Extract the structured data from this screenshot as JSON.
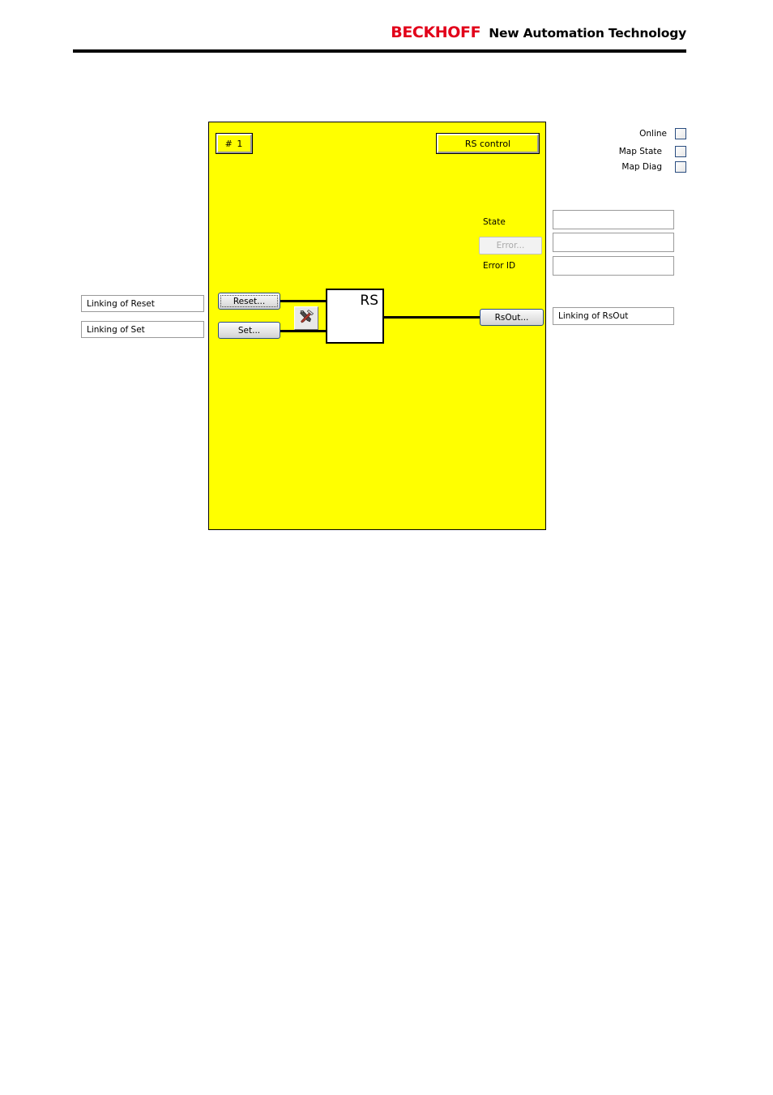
{
  "header": {
    "brand_name": "BECKHOFF",
    "tagline": "New Automation Technology"
  },
  "editor": {
    "index_button": "# 1",
    "title_button": "RS control",
    "state_label": "State",
    "error_button": "Error...",
    "error_id_label": "Error ID",
    "reset_button": "Reset...",
    "set_button": "Set...",
    "rsout_button": "RsOut...",
    "tools_button_icon": "tools-icon",
    "function_block_label": "RS",
    "panel_color": "#ffff00",
    "block_color": "#ffffff"
  },
  "options": {
    "online_label": "Online",
    "map_state_label": "Map State",
    "map_diag_label": "Map Diag",
    "online_checked": false,
    "map_state_checked": false,
    "map_diag_checked": false
  },
  "fields": {
    "linking_of_reset": "Linking of Reset",
    "linking_of_set": "Linking of Set",
    "linking_of_rsout": "Linking of RsOut",
    "state_value": "",
    "error_value": "",
    "error_id_value": ""
  }
}
